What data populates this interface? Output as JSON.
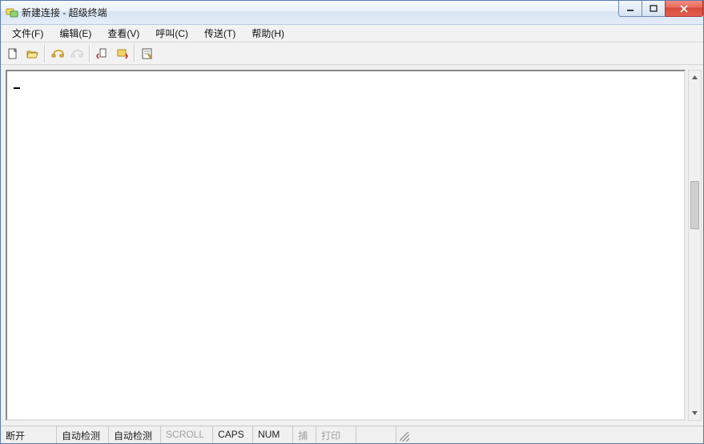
{
  "window": {
    "title": "新建连接 - 超级终端"
  },
  "menu": {
    "items": [
      {
        "label": "文件(F)"
      },
      {
        "label": "编辑(E)"
      },
      {
        "label": "查看(V)"
      },
      {
        "label": "呼叫(C)"
      },
      {
        "label": "传送(T)"
      },
      {
        "label": "帮助(H)"
      }
    ]
  },
  "toolbar": {
    "icons": {
      "new": "new-file-icon",
      "open": "open-folder-icon",
      "connect": "phone-connect-icon",
      "disconnect": "phone-disconnect-icon",
      "send": "send-file-icon",
      "receive": "receive-file-icon",
      "properties": "properties-icon"
    }
  },
  "terminal": {
    "content": ""
  },
  "status": {
    "connection": "断开",
    "detect1": "自动检测",
    "detect2": "自动检测",
    "scroll": "SCROLL",
    "caps": "CAPS",
    "num": "NUM",
    "capture": "捕",
    "print": "打印"
  }
}
